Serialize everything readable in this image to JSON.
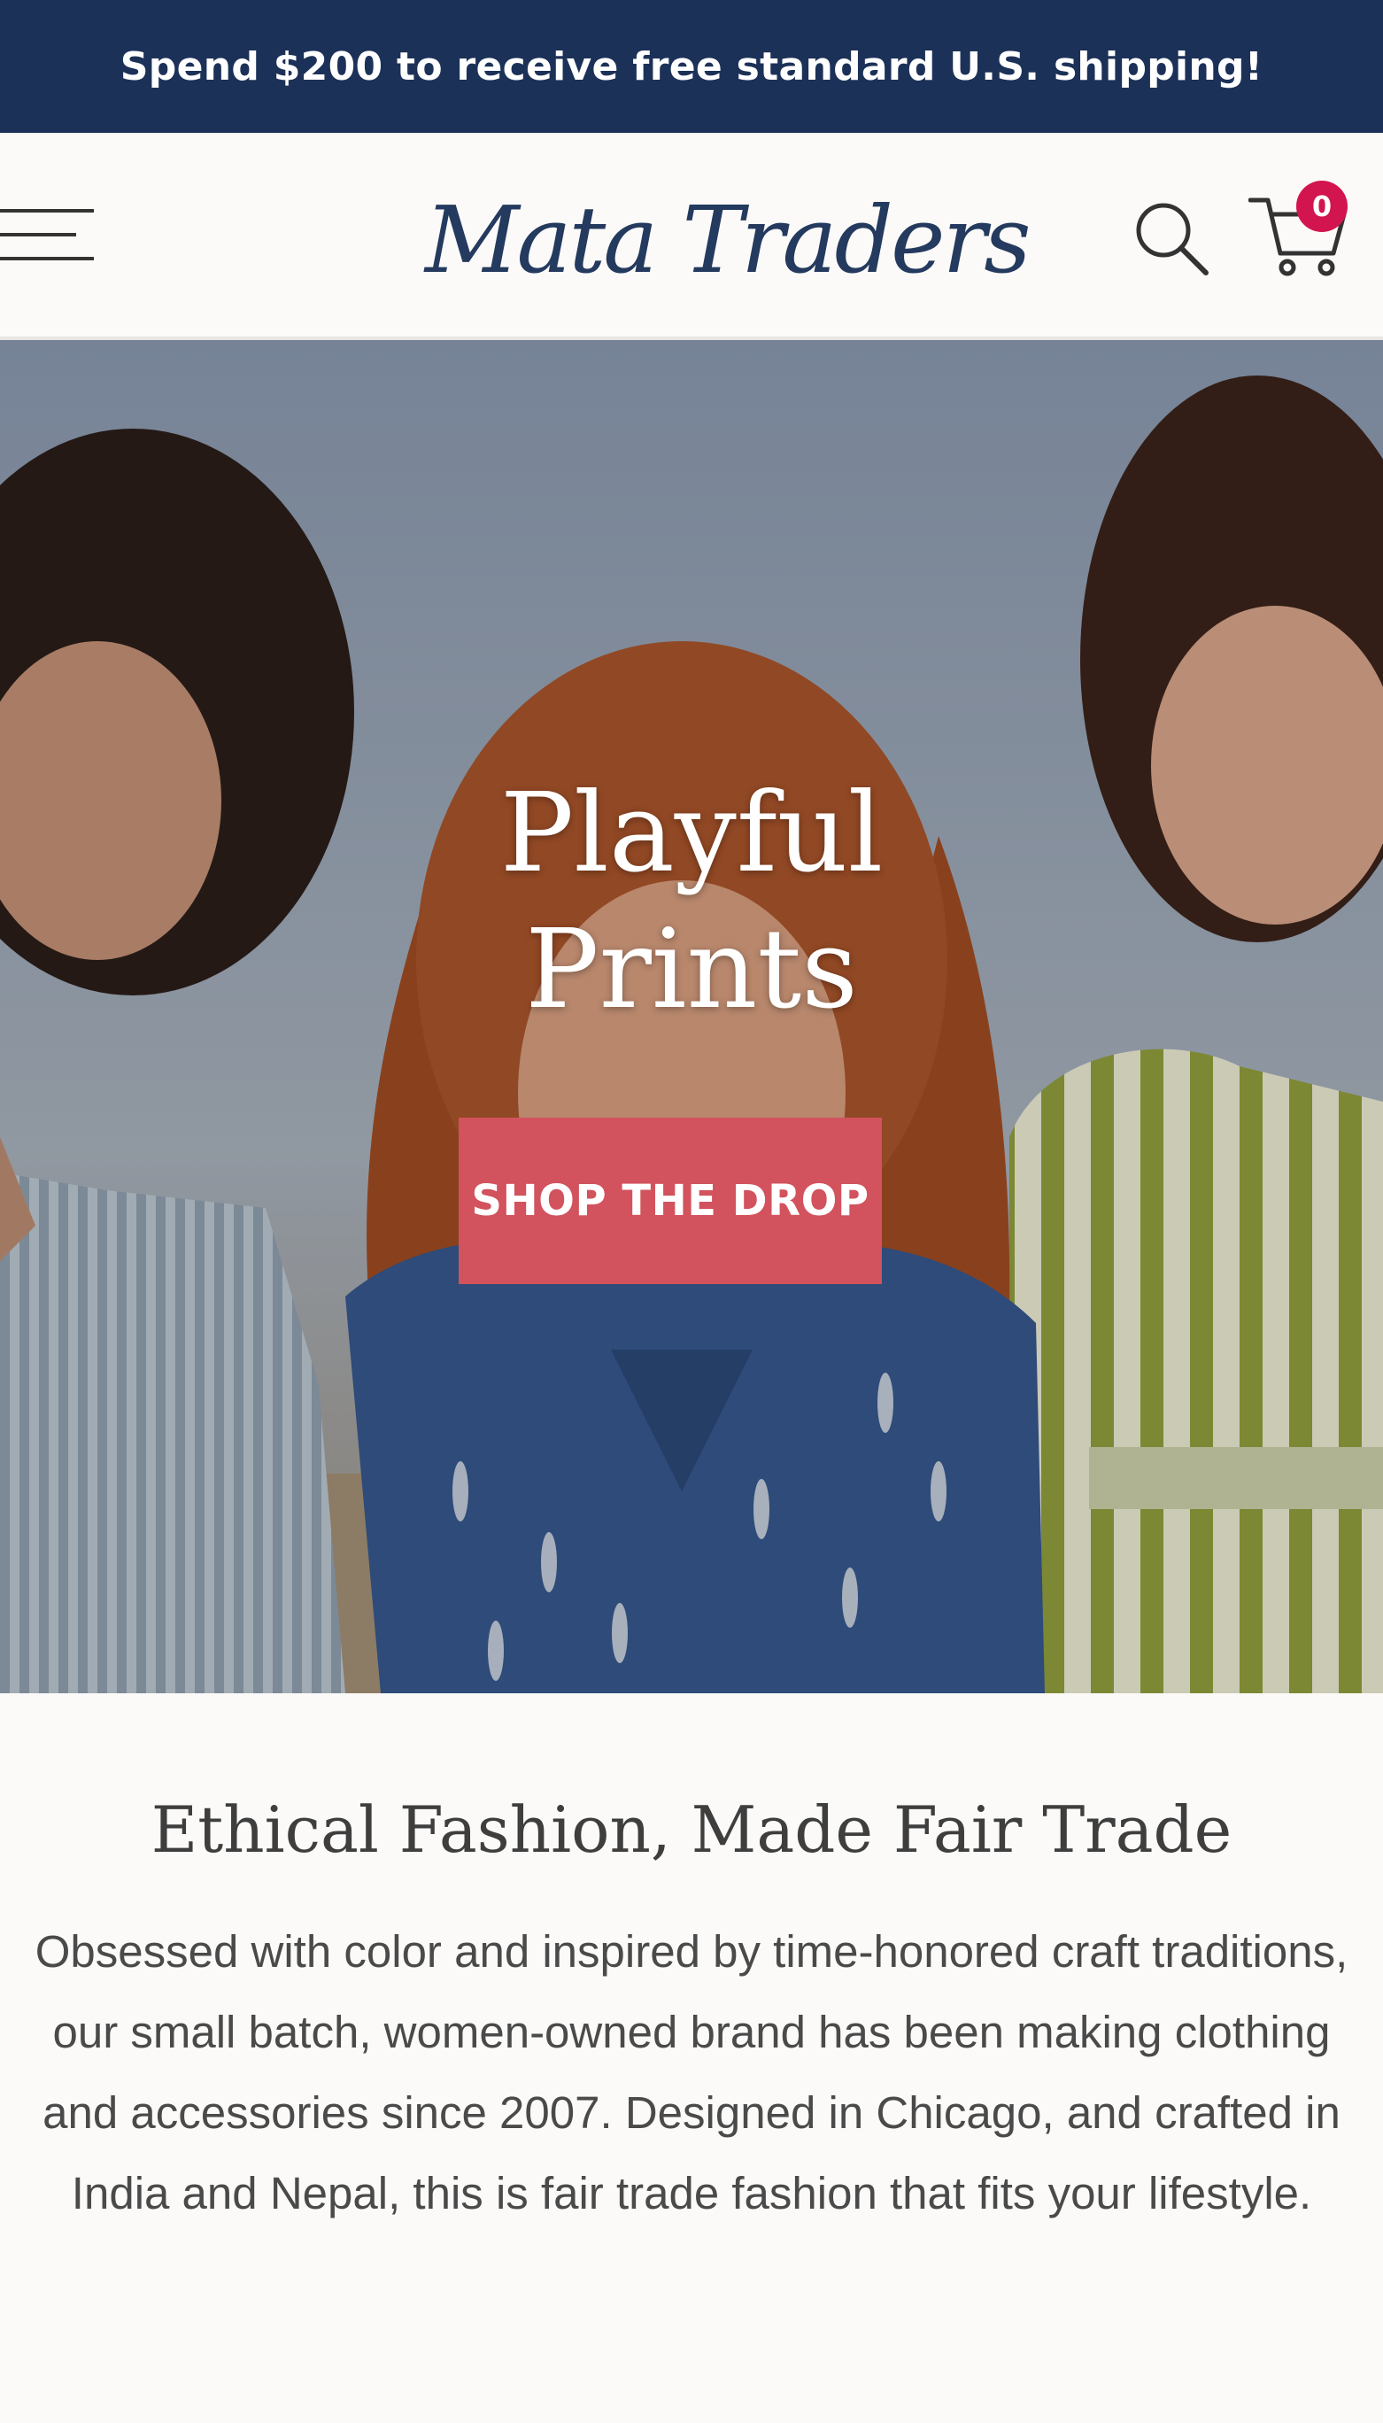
{
  "announcement": {
    "text": "Spend $200 to receive free standard U.S. shipping!"
  },
  "header": {
    "logo_text": "Mata Traders",
    "cart_count": "0",
    "icons": {
      "menu": "hamburger-menu-icon",
      "search": "search-icon",
      "cart": "cart-icon"
    }
  },
  "hero": {
    "title_line1": "Playful",
    "title_line2": "Prints",
    "cta_label": "SHOP THE DROP"
  },
  "intro": {
    "heading": "Ethical Fashion, Made Fair Trade",
    "body": "Obsessed with color and inspired by time-honored craft traditions, our small batch, women-owned brand has been making clothing and accessories since 2007. Designed in Chicago, and crafted in India and Nepal, this is fair trade fashion that fits your lifestyle."
  },
  "colors": {
    "announcement_bg": "#1c3158",
    "logo_blue": "#243a5e",
    "logo_pink": "#d2154f",
    "cta_bg": "#d2525d",
    "page_bg": "#fbfaf8"
  }
}
